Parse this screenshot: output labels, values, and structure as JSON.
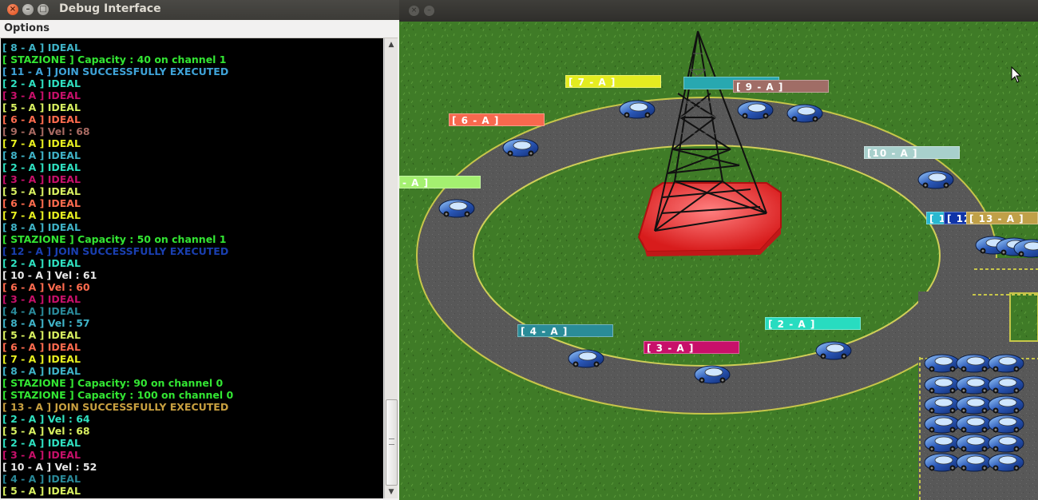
{
  "debug_window": {
    "title": "Debug Interface",
    "close_glyph": "×",
    "min_glyph": "–",
    "max_glyph": "□",
    "menu": {
      "options_label": "Options"
    },
    "log": [
      {
        "text": "[ 8 - A ] IDEAL",
        "color": "#3fb3c7"
      },
      {
        "text": "[ STAZIONE ] Capacity : 40 on channel 1",
        "color": "#33e633"
      },
      {
        "text": "[ 11 - A ] JOIN SUCCESSFULLY EXECUTED",
        "color": "#3fa3d8"
      },
      {
        "text": "[ 2 - A ] IDEAL",
        "color": "#2fe0c0"
      },
      {
        "text": "[ 3 - A ] IDEAL",
        "color": "#c8106a"
      },
      {
        "text": "[ 5 - A ] IDEAL",
        "color": "#d8f060"
      },
      {
        "text": "[ 6 - A ] IDEAL",
        "color": "#ff6b4e"
      },
      {
        "text": "[ 9 - A ] Vel : 68",
        "color": "#a86a62"
      },
      {
        "text": "[ 7 - A ] IDEAL",
        "color": "#e8f020"
      },
      {
        "text": "[ 8 - A ] IDEAL",
        "color": "#3fb3c7"
      },
      {
        "text": "[ 2 - A ] IDEAL",
        "color": "#2fe0c0"
      },
      {
        "text": "[ 3 - A ] IDEAL",
        "color": "#c8106a"
      },
      {
        "text": "[ 5 - A ] IDEAL",
        "color": "#d8f060"
      },
      {
        "text": "[ 6 - A ] IDEAL",
        "color": "#ff6b4e"
      },
      {
        "text": "[ 7 - A ] IDEAL",
        "color": "#e8f020"
      },
      {
        "text": "[ 8 - A ] IDEAL",
        "color": "#3fb3c7"
      },
      {
        "text": "[ STAZIONE ] Capacity : 50 on channel 1",
        "color": "#33e633"
      },
      {
        "text": "[ 12 - A ] JOIN SUCCESSFULLY EXECUTED",
        "color": "#1a3fb0"
      },
      {
        "text": "[ 2 - A ] IDEAL",
        "color": "#2fe0c0"
      },
      {
        "text": "[ 10 - A ] Vel : 61",
        "color": "#e8e8e8"
      },
      {
        "text": "[ 6 - A ] Vel : 60",
        "color": "#ff6b4e"
      },
      {
        "text": "[ 3 - A ] IDEAL",
        "color": "#c8106a"
      },
      {
        "text": "[ 4 - A ] IDEAL",
        "color": "#2a8a9a"
      },
      {
        "text": "[ 8 - A ] Vel : 57",
        "color": "#3fb3c7"
      },
      {
        "text": "[ 5 - A ] IDEAL",
        "color": "#d8f060"
      },
      {
        "text": "[ 6 - A ] IDEAL",
        "color": "#ff6b4e"
      },
      {
        "text": "[ 7 - A ] IDEAL",
        "color": "#e8f020"
      },
      {
        "text": "[ 8 - A ] IDEAL",
        "color": "#3fb3c7"
      },
      {
        "text": "[ STAZIONE ] Capacity: 90 on channel 0",
        "color": "#33e633"
      },
      {
        "text": "[ STAZIONE ] Capacity : 100 on channel 0",
        "color": "#33e633"
      },
      {
        "text": "[ 13 - A ] JOIN SUCCESSFULLY EXECUTED",
        "color": "#c8a040"
      },
      {
        "text": "[ 2 - A ] Vel : 64",
        "color": "#2fe0c0"
      },
      {
        "text": "[ 5 - A ] Vel : 68",
        "color": "#d8f060"
      },
      {
        "text": "[ 2 - A ] IDEAL",
        "color": "#2fe0c0"
      },
      {
        "text": "[ 3 - A ] IDEAL",
        "color": "#c8106a"
      },
      {
        "text": "[ 10 - A ] Vel : 52",
        "color": "#e8e8e8"
      },
      {
        "text": "[ 4 - A ] IDEAL",
        "color": "#2a8a9a"
      },
      {
        "text": "[ 5 - A ] IDEAL",
        "color": "#d8f060"
      }
    ],
    "scroll_up_glyph": "▲",
    "scroll_down_glyph": "▼"
  },
  "sim_window": {
    "close_glyph": "×",
    "min_glyph": "–",
    "car_tags": [
      {
        "label": "[ 7 - A ]",
        "color": "#e4ec20"
      },
      {
        "label": "[ 9 - A ]",
        "color": "#a06d66"
      },
      {
        "label": "[ 6 - A ]",
        "color": "#f8684e"
      },
      {
        "label": "[10 - A ]",
        "color": "#a8d0cc"
      },
      {
        "label": "- A ]",
        "color": "#a4f070"
      },
      {
        "label": "[ 1",
        "color": "#28b8d0"
      },
      {
        "label": "[ 12",
        "color": "#1034a8"
      },
      {
        "label": "[ 13 - A ]",
        "color": "#c0a048"
      },
      {
        "label": "[ 4 - A ]",
        "color": "#2a8c98"
      },
      {
        "label": "[ 3 - A ]",
        "color": "#c8106a"
      },
      {
        "label": "[ 2 - A ]",
        "color": "#28dcc0"
      }
    ],
    "colors": {
      "grass": "#3e7a26",
      "road": "#5a5a5a",
      "tower": "#222222",
      "tower_base": "#ee3a3a"
    }
  }
}
